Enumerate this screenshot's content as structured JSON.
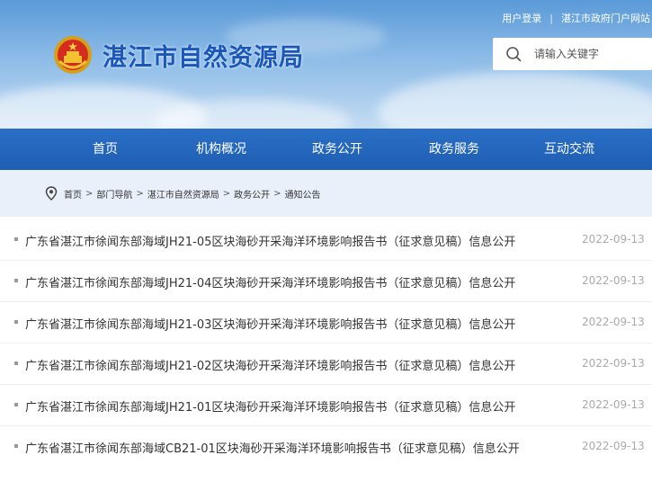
{
  "header": {
    "top_links": {
      "login": "用户登录",
      "separator": "|",
      "portal": "湛江市政府门户网站"
    },
    "site_title": "湛江市自然资源局",
    "search": {
      "placeholder": "请输入关键字"
    }
  },
  "nav": {
    "items": [
      {
        "label": "首页"
      },
      {
        "label": "机构概况"
      },
      {
        "label": "政务公开"
      },
      {
        "label": "政务服务"
      },
      {
        "label": "互动交流"
      }
    ]
  },
  "breadcrumb": {
    "items": [
      "首页",
      "部门导航",
      "湛江市自然资源局",
      "政务公开",
      "通知公告"
    ],
    "arrow": ">"
  },
  "notices": [
    {
      "title": "广东省湛江市徐闻东部海域JH21-05区块海砂开采海洋环境影响报告书（征求意见稿）信息公开",
      "date": "2022-09-13"
    },
    {
      "title": "广东省湛江市徐闻东部海域JH21-04区块海砂开采海洋环境影响报告书（征求意见稿）信息公开",
      "date": "2022-09-13"
    },
    {
      "title": "广东省湛江市徐闻东部海域JH21-03区块海砂开采海洋环境影响报告书（征求意见稿）信息公开",
      "date": "2022-09-13"
    },
    {
      "title": "广东省湛江市徐闻东部海域JH21-02区块海砂开采海洋环境影响报告书（征求意见稿）信息公开",
      "date": "2022-09-13"
    },
    {
      "title": "广东省湛江市徐闻东部海域JH21-01区块海砂开采海洋环境影响报告书（征求意见稿）信息公开",
      "date": "2022-09-13"
    },
    {
      "title": "广东省湛江市徐闻东部海域CB21-01区块海砂开采海洋环境影响报告书（征求意见稿）信息公开",
      "date": "2022-09-13"
    }
  ],
  "colors": {
    "nav_bg": "#1e5eb3",
    "title_blue": "#1a57b8",
    "breadcrumb_bg": "#e9f0f9"
  },
  "icons": {
    "emblem": "national-emblem-icon",
    "search": "search-icon",
    "location": "location-pin-icon"
  }
}
